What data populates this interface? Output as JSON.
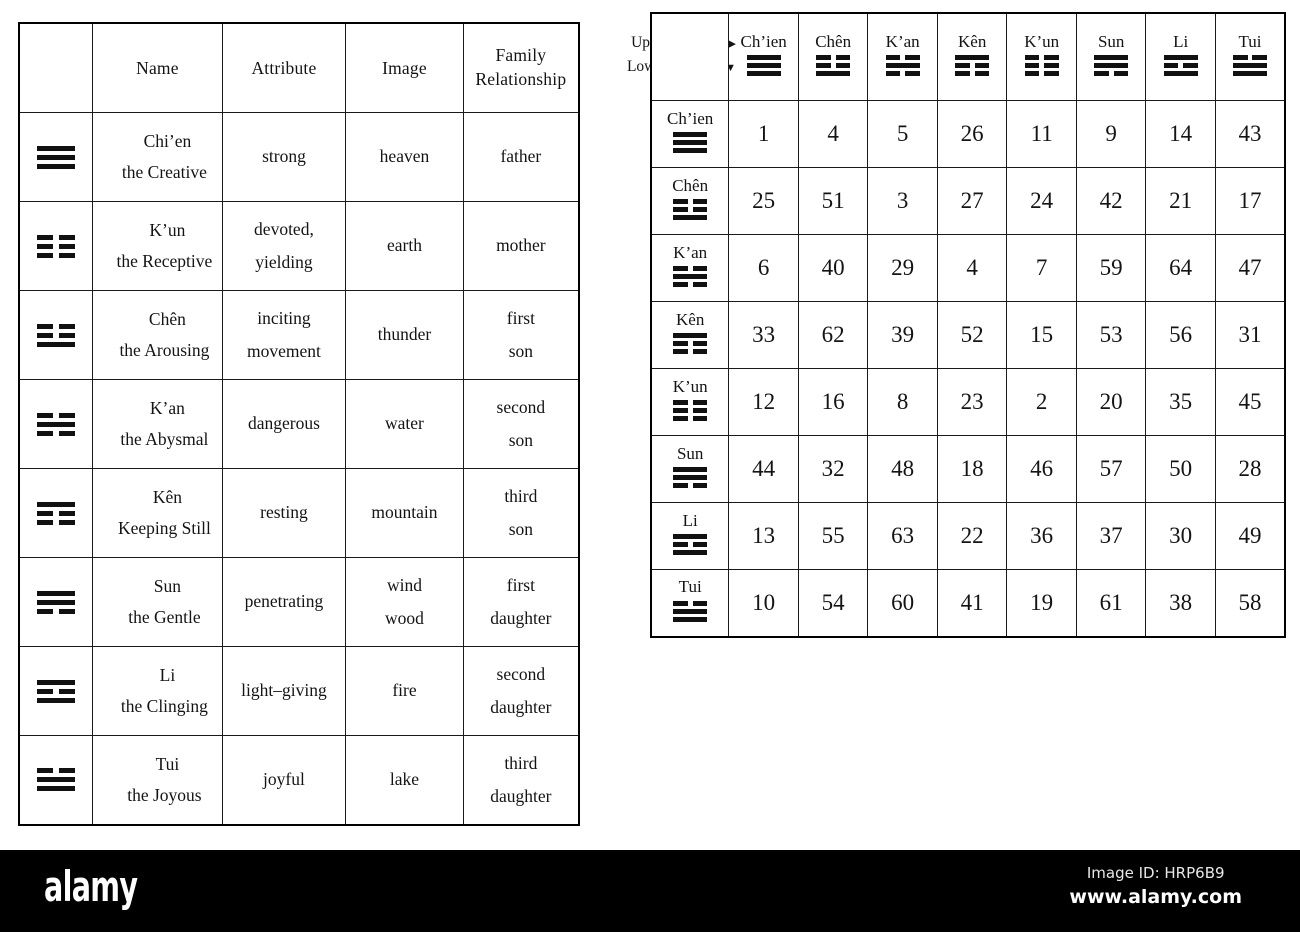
{
  "trigram_table": {
    "headers": [
      "",
      "Name",
      "Attribute",
      "Image",
      "Family Relationship"
    ],
    "header_family_line1": "Family",
    "header_family_line2": "Relationship",
    "rows": [
      {
        "symbol": "chien-trigram",
        "lines": [
          "solid",
          "solid",
          "solid"
        ],
        "name1": "Chi’en",
        "name2": "the Creative",
        "attribute": "strong",
        "image": "heaven",
        "family1": "father",
        "family2": ""
      },
      {
        "symbol": "kun-trigram",
        "lines": [
          "broken",
          "broken",
          "broken"
        ],
        "name1": "K’un",
        "name2": "the Receptive",
        "attribute1": "devoted,",
        "attribute2": "yielding",
        "attribute": "",
        "image": "earth",
        "family1": "mother",
        "family2": ""
      },
      {
        "symbol": "chen-trigram",
        "lines": [
          "broken",
          "broken",
          "solid"
        ],
        "name1": "Chên",
        "name2": "the Arousing",
        "attribute1": "inciting",
        "attribute2": "movement",
        "attribute": "",
        "image": "thunder",
        "family1": "first",
        "family2": "son"
      },
      {
        "symbol": "kan-trigram",
        "lines": [
          "broken",
          "solid",
          "broken"
        ],
        "name1": "K’an",
        "name2": "the Abysmal",
        "attribute": "dangerous",
        "image": "water",
        "family1": "second",
        "family2": "son"
      },
      {
        "symbol": "ken-trigram",
        "lines": [
          "solid",
          "broken",
          "broken"
        ],
        "name1": "Kên",
        "name2": "Keeping Still",
        "attribute": "resting",
        "image": "mountain",
        "family1": "third",
        "family2": "son"
      },
      {
        "symbol": "sun-trigram",
        "lines": [
          "solid",
          "solid",
          "broken"
        ],
        "name1": "Sun",
        "name2": "the Gentle",
        "attribute": "penetrating",
        "image1": "wind",
        "image2": "wood",
        "image": "",
        "family1": "first",
        "family2": "daughter"
      },
      {
        "symbol": "li-trigram",
        "lines": [
          "solid",
          "broken",
          "solid"
        ],
        "name1": "Li",
        "name2": "the Clinging",
        "attribute": "light–giving",
        "image": "fire",
        "family1": "second",
        "family2": "daughter"
      },
      {
        "symbol": "tui-trigram",
        "lines": [
          "broken",
          "solid",
          "solid"
        ],
        "name1": "Tui",
        "name2": "the Joyous",
        "attribute": "joyful",
        "image": "lake",
        "family1": "third",
        "family2": "daughter"
      }
    ]
  },
  "hexagram_table": {
    "axis_upper_label": "Upper Trigram",
    "axis_lower_label": "Lower Trigram",
    "axis_upper_arrow": "▶",
    "axis_lower_arrow": "▼",
    "columns": [
      {
        "name": "Ch’ien",
        "lines": [
          "solid",
          "solid",
          "solid"
        ]
      },
      {
        "name": "Chên",
        "lines": [
          "broken",
          "broken",
          "solid"
        ]
      },
      {
        "name": "K’an",
        "lines": [
          "broken",
          "solid",
          "broken"
        ]
      },
      {
        "name": "Kên",
        "lines": [
          "solid",
          "broken",
          "broken"
        ]
      },
      {
        "name": "K’un",
        "lines": [
          "broken",
          "broken",
          "broken"
        ]
      },
      {
        "name": "Sun",
        "lines": [
          "solid",
          "solid",
          "broken"
        ]
      },
      {
        "name": "Li",
        "lines": [
          "solid",
          "broken",
          "solid"
        ]
      },
      {
        "name": "Tui",
        "lines": [
          "broken",
          "solid",
          "solid"
        ]
      }
    ],
    "rows": [
      {
        "name": "Ch’ien",
        "lines": [
          "solid",
          "solid",
          "solid"
        ],
        "values": [
          1,
          4,
          5,
          26,
          11,
          9,
          14,
          43
        ]
      },
      {
        "name": "Chên",
        "lines": [
          "broken",
          "broken",
          "solid"
        ],
        "values": [
          25,
          51,
          3,
          27,
          24,
          42,
          21,
          17
        ]
      },
      {
        "name": "K’an",
        "lines": [
          "broken",
          "solid",
          "broken"
        ],
        "values": [
          6,
          40,
          29,
          4,
          7,
          59,
          64,
          47
        ]
      },
      {
        "name": "Kên",
        "lines": [
          "solid",
          "broken",
          "broken"
        ],
        "values": [
          33,
          62,
          39,
          52,
          15,
          53,
          56,
          31
        ]
      },
      {
        "name": "K’un",
        "lines": [
          "broken",
          "broken",
          "broken"
        ],
        "values": [
          12,
          16,
          8,
          23,
          2,
          20,
          35,
          45
        ]
      },
      {
        "name": "Sun",
        "lines": [
          "solid",
          "solid",
          "broken"
        ],
        "values": [
          44,
          32,
          48,
          18,
          46,
          57,
          50,
          28
        ]
      },
      {
        "name": "Li",
        "lines": [
          "solid",
          "broken",
          "solid"
        ],
        "values": [
          13,
          55,
          63,
          22,
          36,
          37,
          30,
          49
        ]
      },
      {
        "name": "Tui",
        "lines": [
          "broken",
          "solid",
          "solid"
        ],
        "values": [
          10,
          54,
          60,
          41,
          19,
          61,
          38,
          58
        ]
      }
    ]
  },
  "footer": {
    "logo": "alamy",
    "image_id": "Image ID: HRP6B9",
    "url": "www.alamy.com"
  }
}
